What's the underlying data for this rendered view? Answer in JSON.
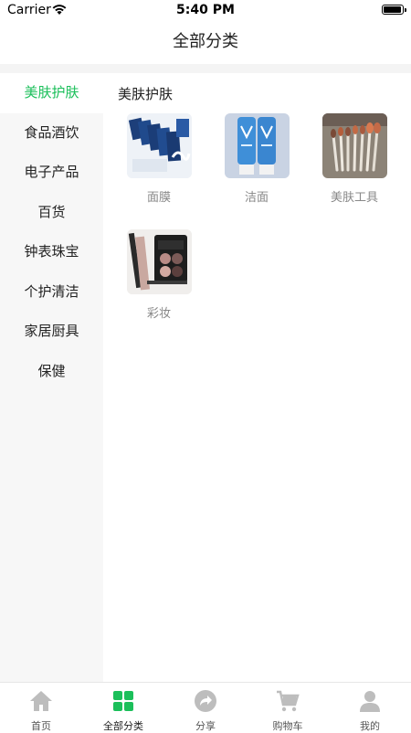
{
  "status": {
    "carrier": "Carrier",
    "time": "5:40 PM"
  },
  "nav": {
    "title": "全部分类"
  },
  "sidebar": {
    "items": [
      {
        "label": "美肤护肤"
      },
      {
        "label": "食品酒饮"
      },
      {
        "label": "电子产品"
      },
      {
        "label": "百货"
      },
      {
        "label": "钟表珠宝"
      },
      {
        "label": "个护清洁"
      },
      {
        "label": "家居厨具"
      },
      {
        "label": "保健"
      }
    ]
  },
  "content": {
    "section_title": "美肤护肤",
    "items": [
      {
        "label": "面膜"
      },
      {
        "label": "洁面"
      },
      {
        "label": "美肤工具"
      },
      {
        "label": "彩妆"
      }
    ]
  },
  "tabbar": {
    "items": [
      {
        "label": "首页",
        "icon": "home-icon"
      },
      {
        "label": "全部分类",
        "icon": "category-grid-icon"
      },
      {
        "label": "分享",
        "icon": "share-icon"
      },
      {
        "label": "购物车",
        "icon": "cart-icon"
      },
      {
        "label": "我的",
        "icon": "user-icon"
      }
    ]
  },
  "colors": {
    "accent": "#1bbf5a",
    "inactive_icon": "#bdbdbd"
  }
}
